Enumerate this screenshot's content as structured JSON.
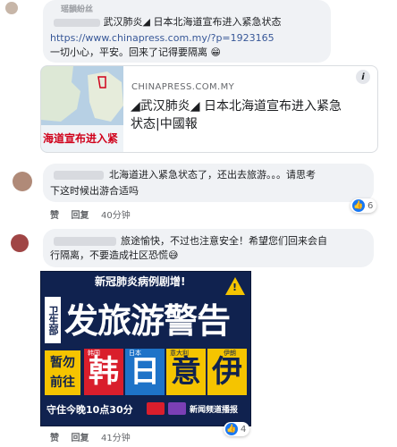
{
  "comment1": {
    "name_partial": "瑶韻紛丝",
    "text_line1": "武汉肺炎◢ 日本北海道宣布进入紧急状态",
    "url": "https://www.chinapress.com.my/?p=1923165",
    "text_line2": "一切小心，平安。回来了记得要隔离",
    "emoji": "😁"
  },
  "link_preview": {
    "domain": "CHINAPRESS.COM.MY",
    "title_line1": "◢武汉肺炎◢ 日本北海道宣布进入紧急",
    "title_line2": "状态|中國報",
    "thumb_caption": "海道宣布进入紧",
    "info_icon": "i"
  },
  "comment2": {
    "text_line1": "北海道进入紧急状态了，还出去旅游。。。请思考",
    "text_line2": "下这时候出游合适吗",
    "actions": {
      "like": "赞",
      "reply": "回复",
      "time": "40分钟"
    },
    "reaction_count": "6"
  },
  "comment3": {
    "text_line1": "旅途愉快，不过也注意安全！希望您们回来会自",
    "text_line2": "行隔离，不要造成社区恐慌",
    "emoji": "😅",
    "actions": {
      "like": "赞",
      "reply": "回复",
      "time": "41分钟"
    },
    "reaction_count": "4"
  },
  "poster": {
    "top_banner": "新冠肺炎病例剧增!",
    "left_vertical": "卫生部",
    "headline": "发旅游警告",
    "left_box": "暂勿前往",
    "countries": [
      {
        "char": "韩",
        "label": "韩国"
      },
      {
        "char": "日",
        "label": "日本"
      },
      {
        "char": "意",
        "label": "意大利"
      },
      {
        "char": "伊",
        "label": "伊朗"
      }
    ],
    "bottom_text": "守住今晚10点30分",
    "bottom_right": "新闻频道播报"
  }
}
